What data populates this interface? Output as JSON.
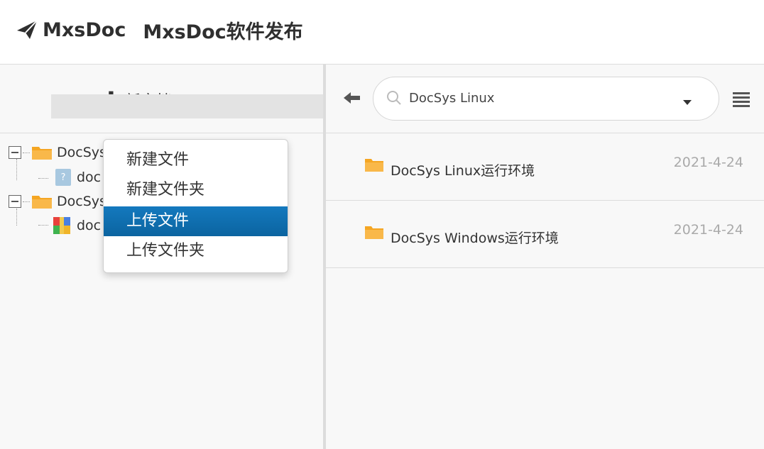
{
  "header": {
    "brand_name": "MxsDoc",
    "repo_title": "MxsDoc软件发布",
    "brand_icon": "paper-plane-icon"
  },
  "left": {
    "new_doc_label": "新文档",
    "tree": [
      {
        "label": "DocSys",
        "icon": "folder-icon",
        "expanded": true
      },
      {
        "label": "doc",
        "icon": "unknown-file-icon",
        "selected": true
      },
      {
        "label": "DocSys",
        "icon": "folder-icon",
        "expanded": true
      },
      {
        "label": "doc",
        "icon": "package-icon"
      }
    ],
    "dropdown": {
      "items": [
        "新建文件",
        "新建文件夹",
        "上传文件",
        "上传文件夹"
      ],
      "active_index": 2
    }
  },
  "right": {
    "search": {
      "value": "DocSys Linux",
      "placeholder": ""
    },
    "files": [
      {
        "name": "DocSys Linux运行环境",
        "date": "2021-4-24",
        "icon": "folder-icon"
      },
      {
        "name": "DocSys Windows运行环境",
        "date": "2021-4-24",
        "icon": "folder-icon"
      }
    ]
  },
  "colors": {
    "folder": "#f5a623",
    "menu_active": "#0f6fad",
    "panel_bg": "#f8f8f8"
  }
}
